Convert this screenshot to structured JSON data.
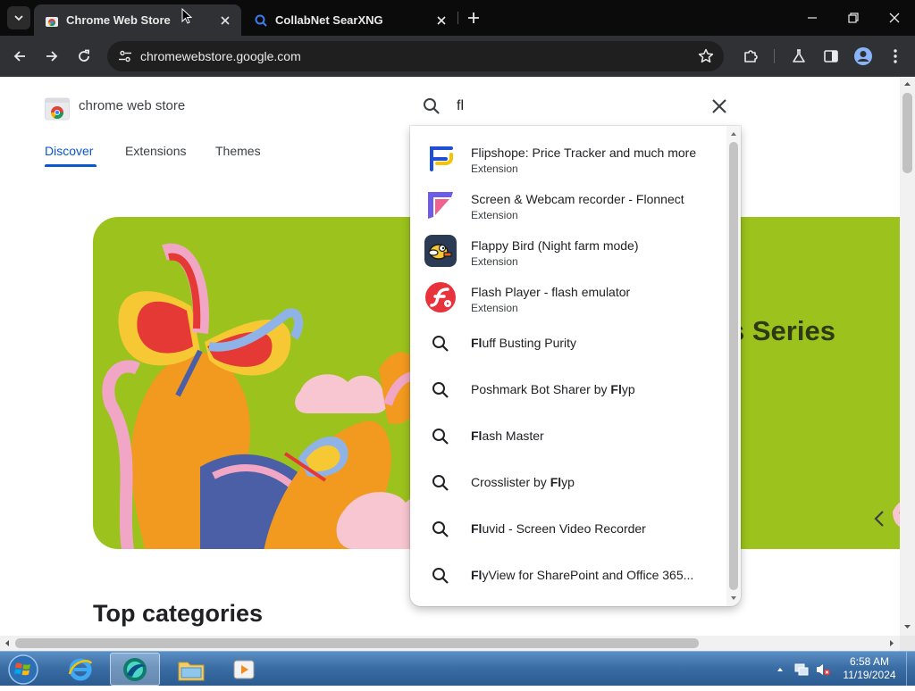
{
  "browser": {
    "tabs": [
      {
        "title": "Chrome Web Store",
        "active": true
      },
      {
        "title": "CollabNet SearXNG",
        "active": false
      }
    ],
    "url": "chromewebstore.google.com"
  },
  "page": {
    "brand": "chrome web store",
    "nav": [
      "Discover",
      "Extensions",
      "Themes"
    ],
    "hero_text": "s Series",
    "section_title": "Top categories"
  },
  "search": {
    "query": "fl",
    "extensions": [
      {
        "name": "Flipshope: Price Tracker and much more",
        "type": "Extension",
        "icon": "flipshope-icon"
      },
      {
        "name": "Screen & Webcam recorder - Flonnect",
        "type": "Extension",
        "icon": "flonnect-icon"
      },
      {
        "name": "Flappy Bird (Night farm mode)",
        "type": "Extension",
        "icon": "flappy-bird-icon"
      },
      {
        "name": "Flash Player - flash emulator",
        "type": "Extension",
        "icon": "flash-player-icon"
      }
    ],
    "suggestions": [
      {
        "before": "",
        "match": "Fl",
        "after": "uff Busting Purity"
      },
      {
        "before": "Poshmark Bot Sharer by ",
        "match": "Fl",
        "after": "yp"
      },
      {
        "before": "",
        "match": "Fl",
        "after": "ash Master"
      },
      {
        "before": "Crosslister by ",
        "match": "Fl",
        "after": "yp"
      },
      {
        "before": "",
        "match": "Fl",
        "after": "uvid - Screen Video Recorder"
      },
      {
        "before": "",
        "match": "Fl",
        "after": "yView for SharePoint and Office 365..."
      }
    ]
  },
  "taskbar": {
    "time": "6:58 AM",
    "date": "11/19/2024"
  },
  "colors": {
    "accent": "#0b57d0",
    "hero_bg": "#9cc31d",
    "chrome_dark": "#303134"
  }
}
